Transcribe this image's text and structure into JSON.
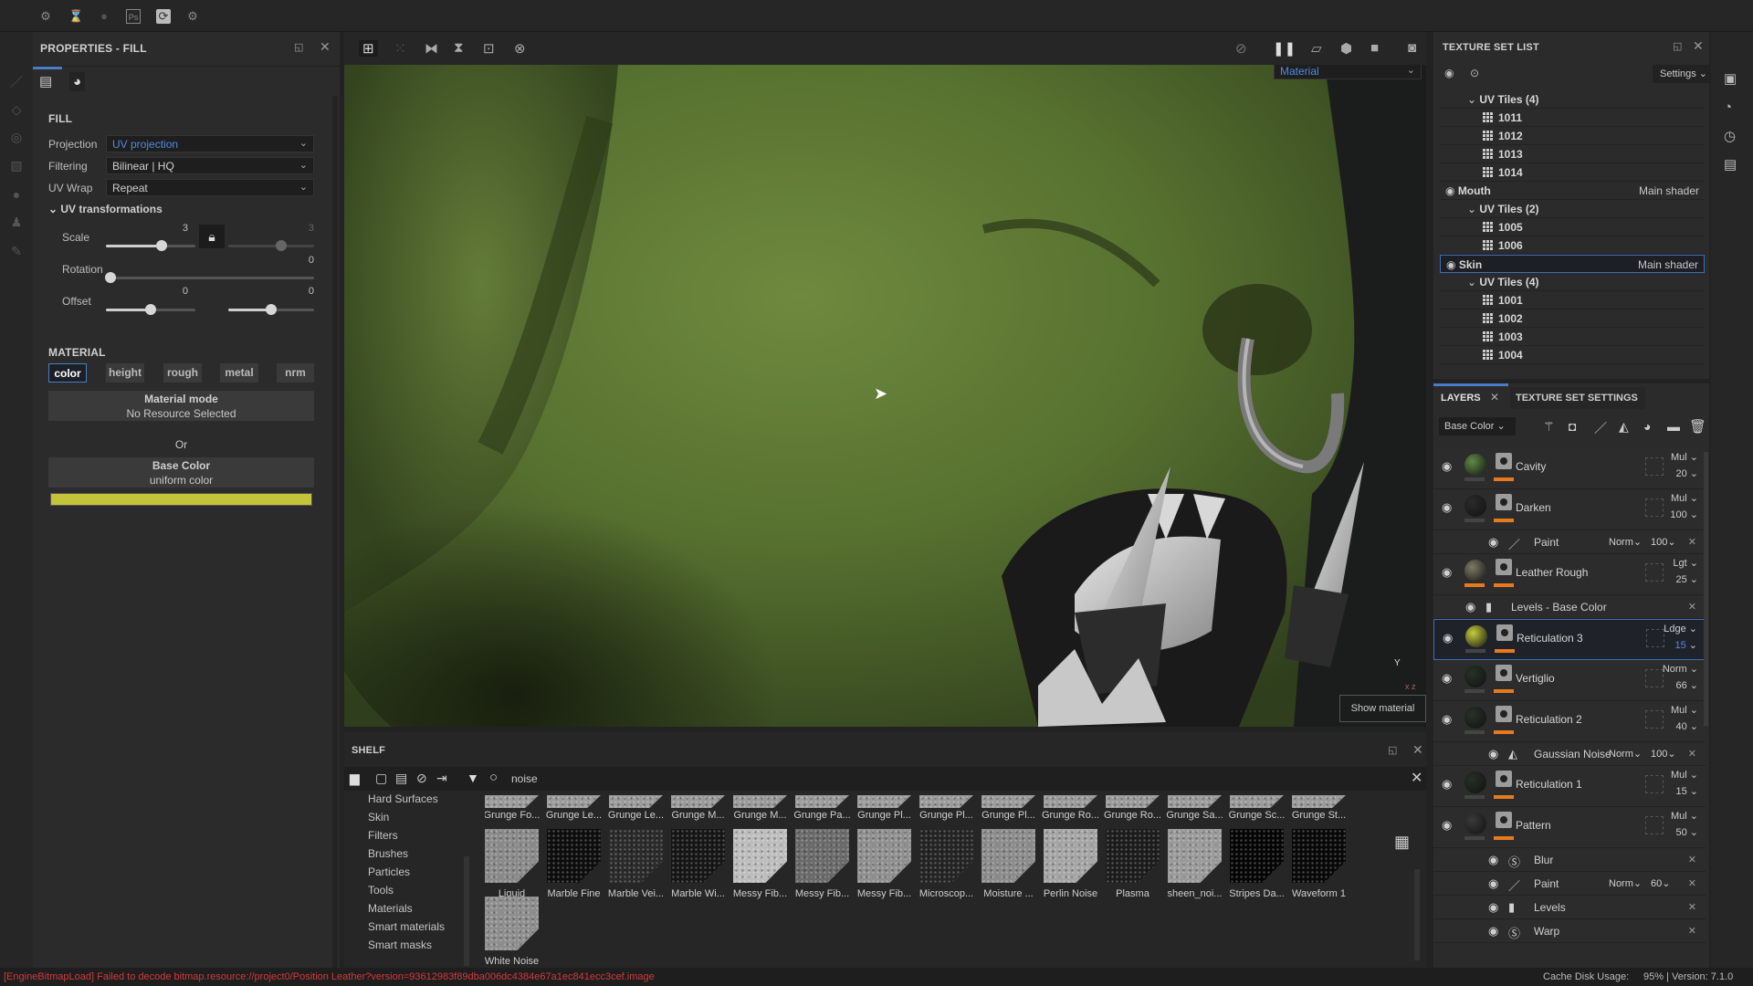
{
  "topbar": {
    "icons": [
      "substance-icon",
      "hourglass-icon",
      "substance-dim-icon",
      "photoshop-icon",
      "sync-icon",
      "substance-icon"
    ]
  },
  "properties": {
    "title": "PROPERTIES - FILL",
    "section_fill": "FILL",
    "projection_label": "Projection",
    "projection_value": "UV projection",
    "filtering_label": "Filtering",
    "filtering_value": "Bilinear | HQ",
    "uvwrap_label": "UV Wrap",
    "uvwrap_value": "Repeat",
    "uvtrans_label": "UV transformations",
    "scale_label": "Scale",
    "scale_u": "3",
    "scale_v": "3",
    "rotation_label": "Rotation",
    "rotation_value": "0",
    "offset_label": "Offset",
    "offset_u": "0",
    "offset_v": "0",
    "section_material": "MATERIAL",
    "channels": [
      "color",
      "height",
      "rough",
      "metal",
      "nrm"
    ],
    "material_mode_title": "Material mode",
    "material_mode_value": "No Resource Selected",
    "or_label": "Or",
    "base_color_title": "Base Color",
    "base_color_value": "uniform color",
    "base_color_hex": "#c3c43a"
  },
  "viewport": {
    "channel_dropdown": "Material",
    "show_material": "Show material",
    "axis_y": "Y",
    "axis_xz": "x z"
  },
  "shelf": {
    "title": "SHELF",
    "search_value": "noise",
    "categories": [
      "Hard Surfaces",
      "Skin",
      "Filters",
      "Brushes",
      "Particles",
      "Tools",
      "Materials",
      "Smart materials",
      "Smart masks"
    ],
    "row1": [
      "Grunge Fo...",
      "Grunge Le...",
      "Grunge Le...",
      "Grunge M...",
      "Grunge M...",
      "Grunge Pa...",
      "Grunge Pl...",
      "Grunge Pl...",
      "Grunge Pl...",
      "Grunge Ro...",
      "Grunge Ro...",
      "Grunge Sa...",
      "Grunge Sc...",
      "Grunge St..."
    ],
    "row2": [
      "Liquid",
      "Marble Fine",
      "Marble Vei...",
      "Marble Wi...",
      "Messy Fib...",
      "Messy Fib...",
      "Messy Fib...",
      "Microscop...",
      "Moisture ...",
      "Perlin Noise",
      "Plasma",
      "sheen_noi...",
      "Stripes Da...",
      "Waveform 1"
    ],
    "row2_shades": [
      "#8a8a8a",
      "#0d0d0d",
      "#2a2a2a",
      "#161616",
      "#bdbdbd",
      "#6a6a6a",
      "#8f8f8f",
      "#242424",
      "#8c8c8c",
      "#a5a5a5",
      "#1c1c1c",
      "#9a9a9a",
      "#050505",
      "#080808"
    ],
    "row3": [
      "White Noise"
    ],
    "row3_shades": [
      "#8e8e8e"
    ]
  },
  "texture_set_list": {
    "title": "TEXTURE SET LIST",
    "settings_label": "Settings",
    "rows": [
      {
        "kind": "group",
        "label": "UV Tiles (4)"
      },
      {
        "kind": "tile",
        "label": "1011"
      },
      {
        "kind": "tile",
        "label": "1012"
      },
      {
        "kind": "tile",
        "label": "1013"
      },
      {
        "kind": "tile",
        "label": "1014"
      },
      {
        "kind": "set",
        "label": "Mouth",
        "shader": "Main shader"
      },
      {
        "kind": "group",
        "label": "UV Tiles (2)"
      },
      {
        "kind": "tile",
        "label": "1005"
      },
      {
        "kind": "tile",
        "label": "1006"
      },
      {
        "kind": "set",
        "label": "Skin",
        "shader": "Main shader",
        "selected": true
      },
      {
        "kind": "group",
        "label": "UV Tiles (4)"
      },
      {
        "kind": "tile",
        "label": "1001"
      },
      {
        "kind": "tile",
        "label": "1002"
      },
      {
        "kind": "tile",
        "label": "1003"
      },
      {
        "kind": "tile",
        "label": "1004"
      }
    ]
  },
  "layers_panel": {
    "tab_layers": "LAYERS",
    "tab_texture_settings": "TEXTURE SET SETTINGS",
    "channel_dropdown": "Base Color",
    "accent_color": "#e87a1e",
    "items": [
      {
        "type": "layer",
        "name": "Cavity",
        "blend": "Mul",
        "opacity": "20",
        "thumb": "#5f8a45"
      },
      {
        "type": "layer",
        "name": "Darken",
        "blend": "Mul",
        "opacity": "100",
        "thumb": "#2a2a2a"
      },
      {
        "type": "effect",
        "name": "Paint",
        "icon": "brush-icon",
        "blend": "Norm",
        "opacity": "100"
      },
      {
        "type": "layer",
        "name": "Leather Rough",
        "blend": "Lgt",
        "opacity": "25",
        "thumb": "#7d7a66",
        "orange_thumb_bar": true
      },
      {
        "type": "effect",
        "name": "Levels - Base Color",
        "icon": "levels-icon",
        "indent": true
      },
      {
        "type": "layer",
        "name": "Reticulation 3",
        "blend": "Ldge",
        "opacity": "15",
        "thumb": "#c5cc3c",
        "selected": true
      },
      {
        "type": "layer",
        "name": "Vertiglio",
        "blend": "Norm",
        "opacity": "66",
        "thumb": "#263326"
      },
      {
        "type": "layer",
        "name": "Reticulation 2",
        "blend": "Mul",
        "opacity": "40",
        "thumb": "#283228"
      },
      {
        "type": "effect",
        "name": "Gaussian Noise",
        "icon": "fill-icon",
        "blend": "Norm",
        "opacity": "100"
      },
      {
        "type": "layer",
        "name": "Reticulation 1",
        "blend": "Mul",
        "opacity": "15",
        "thumb": "#263026"
      },
      {
        "type": "layer",
        "name": "Pattern",
        "blend": "Mul",
        "opacity": "50",
        "thumb": "#3a3a3a"
      },
      {
        "type": "effect",
        "name": "Blur",
        "icon": "substance-filter-icon"
      },
      {
        "type": "effect",
        "name": "Paint",
        "icon": "brush-icon",
        "blend": "Norm",
        "opacity": "60"
      },
      {
        "type": "effect",
        "name": "Levels",
        "icon": "levels-icon"
      },
      {
        "type": "effect",
        "name": "Warp",
        "icon": "substance-filter-icon"
      }
    ]
  },
  "status": {
    "error": "[EngineBitmapLoad] Failed to decode bitmap.resource://project0/Position Leather?version=93612983f89dba006dc4384e67a1ec841ecc3cef.image",
    "error_color": "#d23a3a",
    "cache_label": "Cache Disk Usage:",
    "cache_value": "95% | Version: 7.1.0"
  }
}
